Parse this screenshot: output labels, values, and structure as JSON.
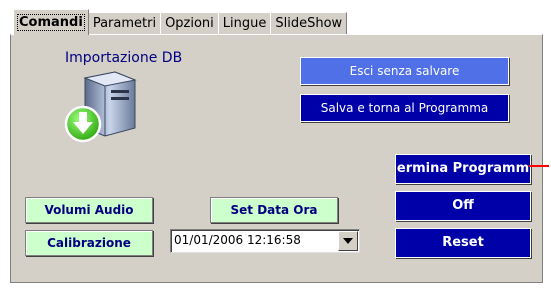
{
  "tabs": [
    "Comandi",
    "Parametri",
    "Opzioni",
    "Lingue",
    "SlideShow"
  ],
  "import": {
    "title": "Importazione DB",
    "icon": "database-download-icon"
  },
  "buttons": {
    "exit_nosave": "Esci senza salvare",
    "save_return": "Salva e torna al Programma",
    "terminate": "ermina Programm",
    "off": "Off",
    "reset": "Reset",
    "audio": "Volumi Audio",
    "set_date": "Set Data Ora",
    "calibration": "Calibrazione"
  },
  "datetime": {
    "value": "01/01/2006  12:16:58"
  },
  "colors": {
    "accent_dark": "#0000a8",
    "accent_light": "#5070e8",
    "green_button": "#ccffcc"
  }
}
